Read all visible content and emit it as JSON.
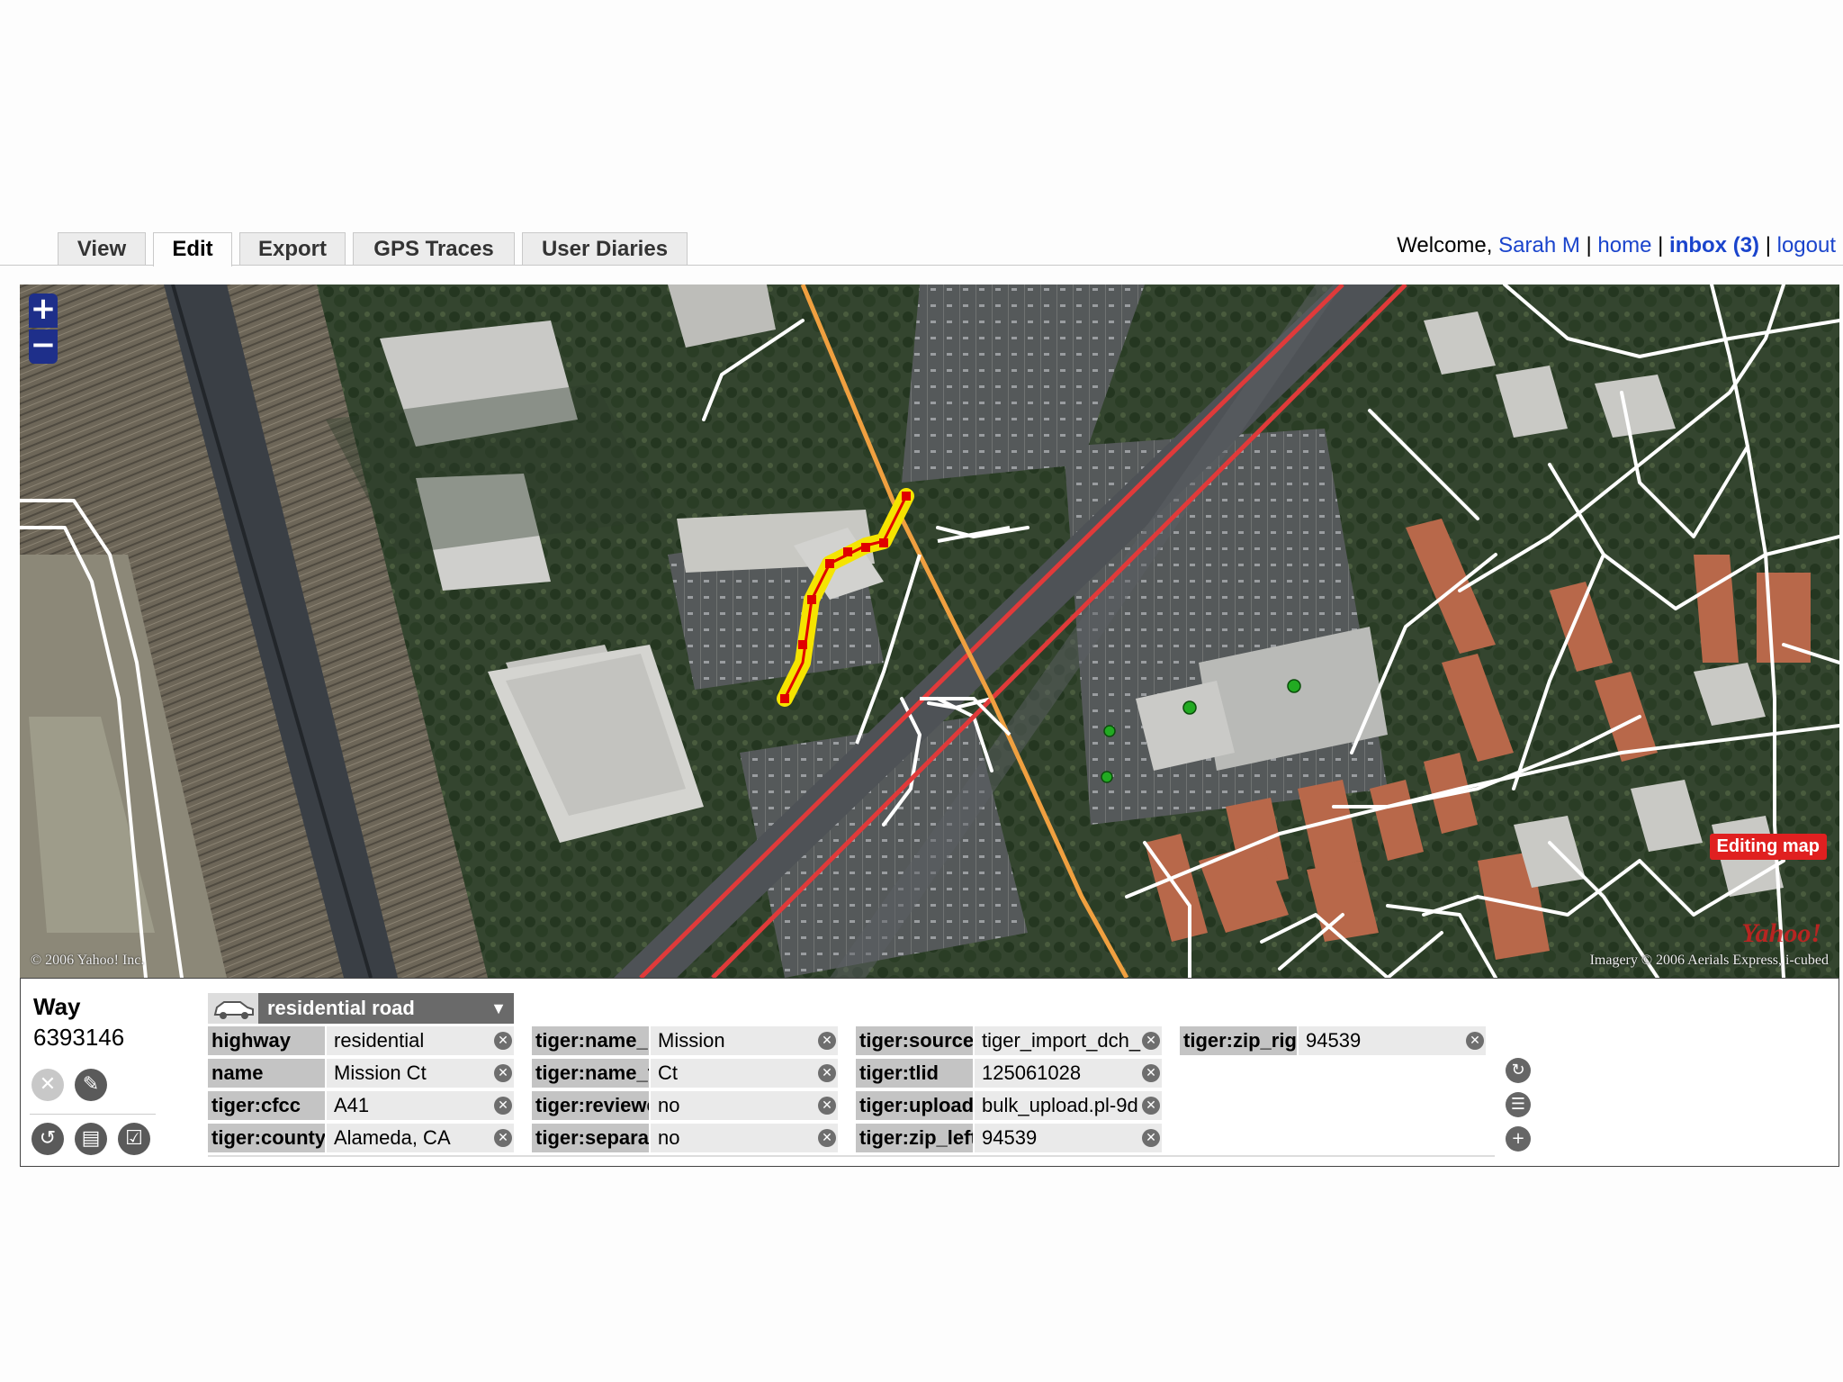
{
  "tabs": [
    {
      "label": "View",
      "active": false
    },
    {
      "label": "Edit",
      "active": true
    },
    {
      "label": "Export",
      "active": false
    },
    {
      "label": "GPS Traces",
      "active": false
    },
    {
      "label": "User Diaries",
      "active": false
    }
  ],
  "user": {
    "welcome": "Welcome,",
    "name": "Sarah M",
    "home": "home",
    "inbox": "inbox (3)",
    "logout": "logout",
    "sep": "|"
  },
  "map": {
    "zoom_in": "+",
    "zoom_out": "−",
    "editing_badge": "Editing map",
    "copyright_left": "© 2006 Yahoo! Inc.",
    "copyright_right": "Imagery © 2006 Aerials Express, i-cubed",
    "logo_text": "Yahoo!"
  },
  "panel": {
    "type": "Way",
    "id": "6393146",
    "preset": "residential road",
    "tags": [
      {
        "key": "highway",
        "value": "residential"
      },
      {
        "key": "name",
        "value": "Mission Ct"
      },
      {
        "key": "tiger:cfcc",
        "value": "A41"
      },
      {
        "key": "tiger:county",
        "value": "Alameda, CA"
      },
      {
        "key": "tiger:name_base",
        "value": "Mission"
      },
      {
        "key": "tiger:name_type",
        "value": "Ct"
      },
      {
        "key": "tiger:reviewed",
        "value": "no"
      },
      {
        "key": "tiger:separated",
        "value": "no"
      },
      {
        "key": "tiger:source",
        "value": "tiger_import_dch_"
      },
      {
        "key": "tiger:tlid",
        "value": "125061028"
      },
      {
        "key": "tiger:upload_uuid",
        "value": "bulk_upload.pl-9d"
      },
      {
        "key": "tiger:zip_left",
        "value": "94539"
      },
      {
        "key": "tiger:zip_right",
        "value": "94539"
      }
    ]
  },
  "colors": {
    "link": "#1a44cc",
    "zoom_control": "#1e2f8a",
    "primary_road": "#e03a3a",
    "secondary_road": "#f0a040",
    "minor_road": "#ffffff",
    "selected_way": "#f5e400",
    "selected_node": "#e00000",
    "poi": "#22aa22",
    "editing_badge": "#e02020"
  }
}
